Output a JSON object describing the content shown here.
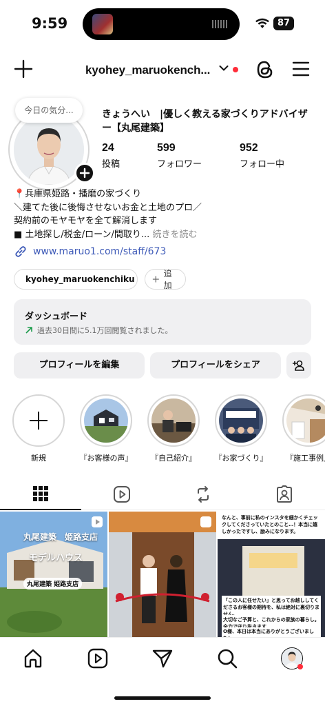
{
  "status_bar": {
    "time": "9:59",
    "battery": "87"
  },
  "header": {
    "username": "kyohey_maruokench..."
  },
  "profile": {
    "note": "今日の気分...",
    "display_name": "きょうへい　|優しく教える家づくりアドバイザー【丸尾建築】",
    "stats": [
      {
        "value": "24",
        "label": "投稿"
      },
      {
        "value": "599",
        "label": "フォロワー"
      },
      {
        "value": "952",
        "label": "フォロー中"
      }
    ],
    "bio_lines": [
      "📍兵庫県姫路・播磨の家づくり",
      "＼建てた後に後悔させないお金と土地のプロ／",
      "契約前のモヤモヤを全て解消します",
      "■ 土地探し/税金/ローン/間取り..."
    ],
    "bio_more": "続きを読む",
    "link": "www.maruo1.com/staff/673",
    "threads_chip": "kyohey_maruokenchiku",
    "add_chip": "追加"
  },
  "dashboard": {
    "title": "ダッシュボード",
    "subtitle": "過去30日間に5.1万回閲覧されました。"
  },
  "buttons": {
    "edit_profile": "プロフィールを編集",
    "share_profile": "プロフィールをシェア"
  },
  "highlights": [
    {
      "label": "新規"
    },
    {
      "label": "『お客様の声』"
    },
    {
      "label": "『自己紹介』"
    },
    {
      "label": "『お家づくり』"
    },
    {
      "label": "『施工事例』"
    }
  ],
  "posts": [
    {
      "line1": "丸尾建築　姫路支店",
      "line2": "モデルハウス",
      "tag": "丸尾建築 姫路支店"
    },
    {
      "line1": ""
    },
    {
      "top_text": "なんと、事前に私のインスタを細かくチェックしてくださっていたとのこと…！本当に嬉しかったですし、励みになります。",
      "box1": "「この人に任せたい」と思ってお越ししてくださるお客様の期待を、私は絶対に裏切りません。",
      "box2": "大切なご予算と、これからの家族の暮らし。全力で守り抜きます",
      "box3": "O様、本日は本当にありがとうございました！"
    }
  ],
  "colors": {
    "link": "#3f5bb8",
    "notification": "#ff2d3a",
    "button_bg": "#efeff1"
  }
}
